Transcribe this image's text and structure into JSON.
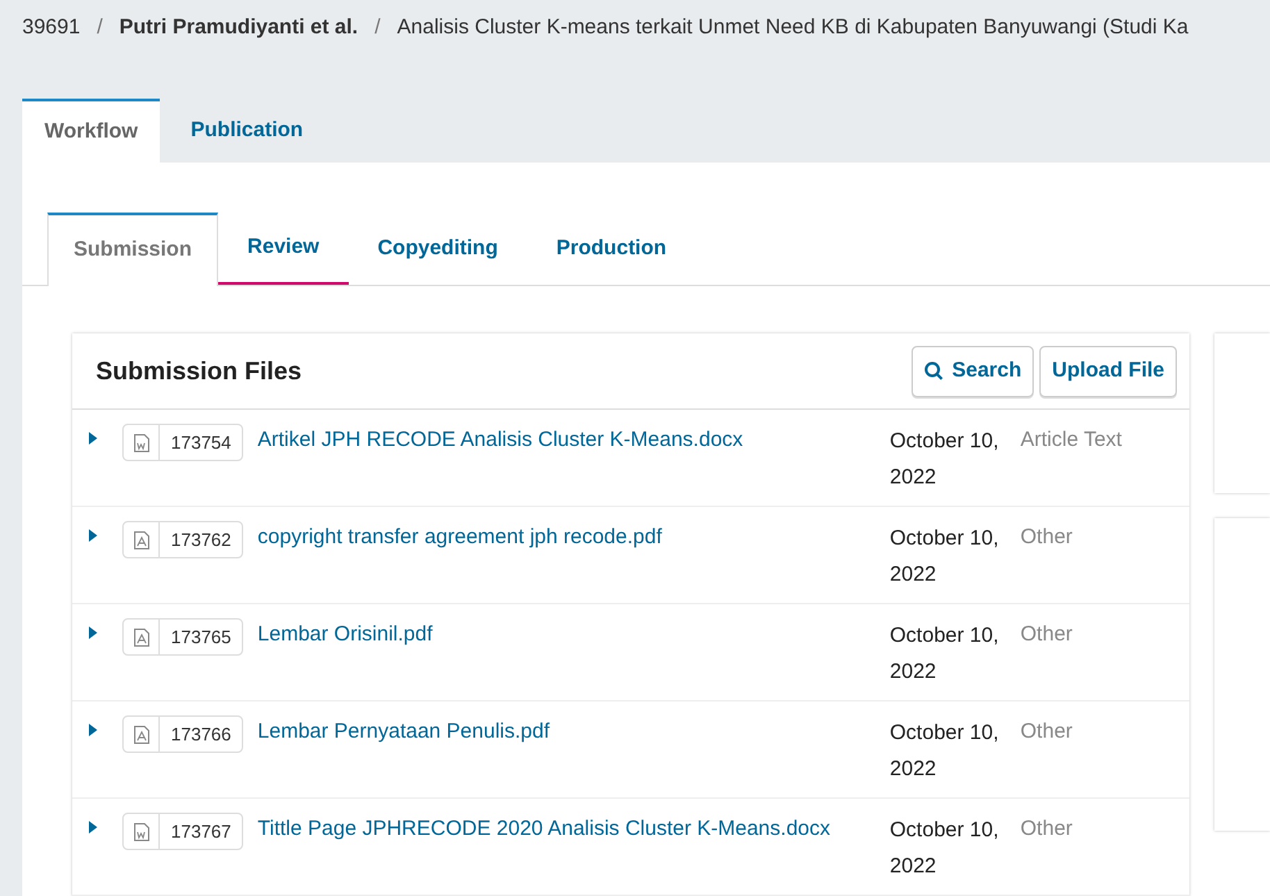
{
  "breadcrumb": {
    "id": "39691",
    "separator": "/",
    "authors": "Putri Pramudiyanti et al.",
    "title": "Analisis Cluster K-means terkait Unmet Need KB di Kabupaten Banyuwangi (Studi Ka"
  },
  "main_tabs": [
    {
      "label": "Workflow",
      "selected": true
    },
    {
      "label": "Publication",
      "selected": false
    }
  ],
  "stage_tabs": [
    {
      "label": "Submission",
      "selected": true,
      "highlighted": false
    },
    {
      "label": "Review",
      "selected": false,
      "highlighted": true
    },
    {
      "label": "Copyediting",
      "selected": false,
      "highlighted": false
    },
    {
      "label": "Production",
      "selected": false,
      "highlighted": false
    }
  ],
  "submission_files": {
    "title": "Submission Files",
    "search_button": "Search",
    "upload_button": "Upload File",
    "rows": [
      {
        "kind": "word",
        "id": "173754",
        "name": "Artikel JPH RECODE Analisis Cluster K-Means.docx",
        "date": "October 10, 2022",
        "component": "Article Text"
      },
      {
        "kind": "pdf",
        "id": "173762",
        "name": "copyright transfer agreement jph recode.pdf",
        "date": "October 10, 2022",
        "component": "Other"
      },
      {
        "kind": "pdf",
        "id": "173765",
        "name": "Lembar Orisinil.pdf",
        "date": "October 10, 2022",
        "component": "Other"
      },
      {
        "kind": "pdf",
        "id": "173766",
        "name": "Lembar Pernyataan Penulis.pdf",
        "date": "October 10, 2022",
        "component": "Other"
      },
      {
        "kind": "word",
        "id": "173767",
        "name": "Tittle Page JPHRECODE 2020 Analisis Cluster K-Means.docx",
        "date": "October 10, 2022",
        "component": "Other"
      }
    ]
  }
}
